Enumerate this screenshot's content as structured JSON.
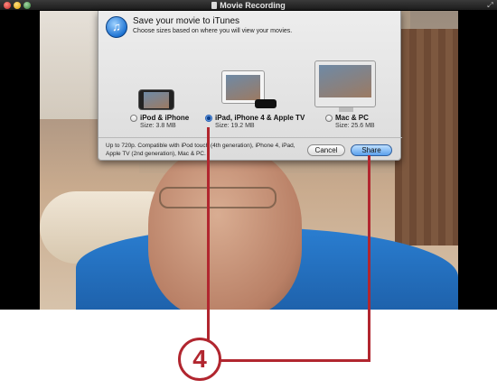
{
  "window": {
    "title": "Movie Recording"
  },
  "dialog": {
    "title": "Save your movie to iTunes",
    "subtitle": "Choose sizes based on where you will view your movies.",
    "options": [
      {
        "label": "iPod & iPhone",
        "size": "Size: 3.8 MB",
        "selected": false
      },
      {
        "label": "iPad, iPhone 4 & Apple TV",
        "size": "Size: 19.2 MB",
        "selected": true
      },
      {
        "label": "Mac & PC",
        "size": "Size: 25.6 MB",
        "selected": false
      }
    ],
    "description": "Up to 720p. Compatible with iPod touch (4th generation), iPhone 4, iPad, Apple TV (2nd generation), Mac & PC.",
    "cancel_label": "Cancel",
    "share_label": "Share"
  },
  "callout": {
    "number": "4",
    "color": "#b1262f"
  },
  "icons": [
    "itunes-icon",
    "document-icon",
    "resize-icon"
  ]
}
